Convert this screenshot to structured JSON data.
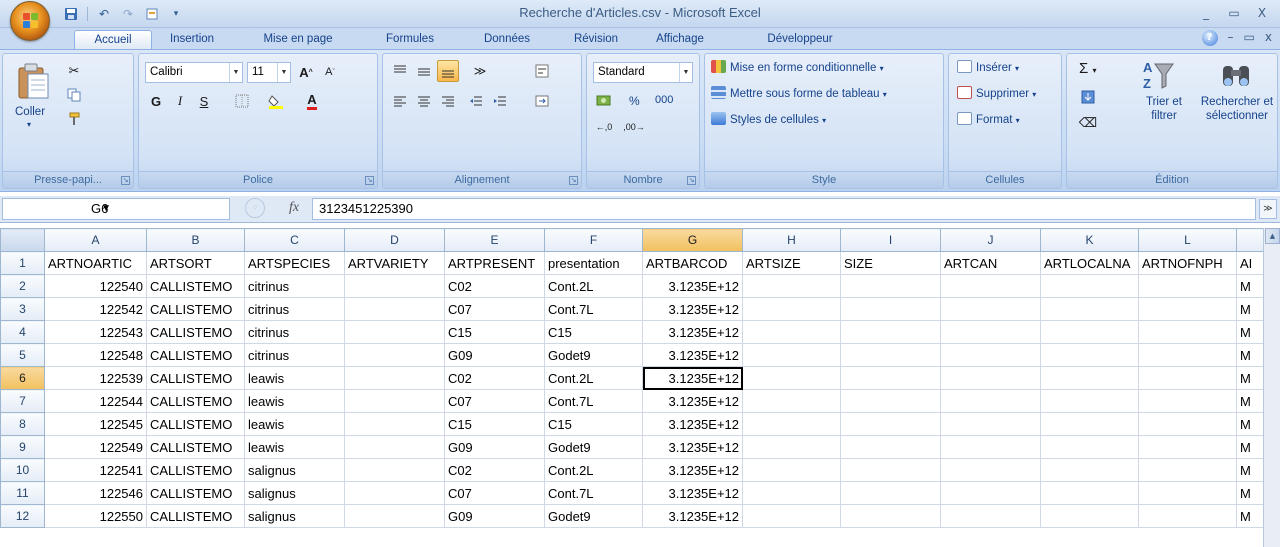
{
  "window": {
    "title": "Recherche d'Articles.csv - Microsoft Excel",
    "controls": [
      "_",
      "▭",
      "X"
    ]
  },
  "tabs": [
    {
      "label": "Accueil",
      "active": true
    },
    {
      "label": "Insertion"
    },
    {
      "label": "Mise en page"
    },
    {
      "label": "Formules"
    },
    {
      "label": "Données"
    },
    {
      "label": "Révision"
    },
    {
      "label": "Affichage"
    },
    {
      "label": "Développeur"
    }
  ],
  "ribbon": {
    "clipboard": {
      "paste_label": "Coller",
      "group_label": "Presse-papi..."
    },
    "font": {
      "name": "Calibri",
      "size": "11",
      "bold": "G",
      "italic": "I",
      "underline": "S",
      "group_label": "Police"
    },
    "alignment": {
      "group_label": "Alignement"
    },
    "number": {
      "format": "Standard",
      "percent": "%",
      "thousands": "000",
      "group_label": "Nombre"
    },
    "style": {
      "conditional": "Mise en forme conditionnelle",
      "table": "Mettre sous forme de tableau",
      "cell_styles": "Styles de cellules",
      "group_label": "Style"
    },
    "cells": {
      "insert": "Insérer",
      "delete": "Supprimer",
      "format": "Format",
      "group_label": "Cellules"
    },
    "editing": {
      "sum": "Σ",
      "sort_line1": "Trier et",
      "sort_line2": "filtrer",
      "find_line1": "Rechercher et",
      "find_line2": "sélectionner",
      "group_label": "Édition"
    }
  },
  "formula_bar": {
    "name_box": "G6",
    "fx": "fx",
    "value": "3123451225390"
  },
  "sheet": {
    "columns": [
      "A",
      "B",
      "C",
      "D",
      "E",
      "F",
      "G",
      "H",
      "I",
      "J",
      "K",
      "L"
    ],
    "selected_column": "G",
    "selected_row": "6",
    "rows": [
      {
        "n": "1",
        "cells": [
          "ARTNOARTIC",
          "ARTSORT",
          "ARTSPECIES",
          "ARTVARIETY",
          "ARTPRESENT",
          "presentation",
          "ARTBARCOD",
          "ARTSIZE",
          "SIZE",
          "ARTCAN",
          "ARTLOCALNA",
          "ARTNOFNPH",
          "AI"
        ]
      },
      {
        "n": "2",
        "cells": [
          "122540",
          "CALLISTEMO",
          "citrinus",
          "",
          "C02",
          "Cont.2L",
          "3.1235E+12",
          "",
          "",
          "",
          "",
          "",
          "M"
        ]
      },
      {
        "n": "3",
        "cells": [
          "122542",
          "CALLISTEMO",
          "citrinus",
          "",
          "C07",
          "Cont.7L",
          "3.1235E+12",
          "",
          "",
          "",
          "",
          "",
          "M"
        ]
      },
      {
        "n": "4",
        "cells": [
          "122543",
          "CALLISTEMO",
          "citrinus",
          "",
          "C15",
          "C15",
          "3.1235E+12",
          "",
          "",
          "",
          "",
          "",
          "M"
        ]
      },
      {
        "n": "5",
        "cells": [
          "122548",
          "CALLISTEMO",
          "citrinus",
          "",
          "G09",
          "Godet9",
          "3.1235E+12",
          "",
          "",
          "",
          "",
          "",
          "M"
        ]
      },
      {
        "n": "6",
        "cells": [
          "122539",
          "CALLISTEMO",
          "leawis",
          "",
          "C02",
          "Cont.2L",
          "3.1235E+12",
          "",
          "",
          "",
          "",
          "",
          "M"
        ]
      },
      {
        "n": "7",
        "cells": [
          "122544",
          "CALLISTEMO",
          "leawis",
          "",
          "C07",
          "Cont.7L",
          "3.1235E+12",
          "",
          "",
          "",
          "",
          "",
          "M"
        ]
      },
      {
        "n": "8",
        "cells": [
          "122545",
          "CALLISTEMO",
          "leawis",
          "",
          "C15",
          "C15",
          "3.1235E+12",
          "",
          "",
          "",
          "",
          "",
          "M"
        ]
      },
      {
        "n": "9",
        "cells": [
          "122549",
          "CALLISTEMO",
          "leawis",
          "",
          "G09",
          "Godet9",
          "3.1235E+12",
          "",
          "",
          "",
          "",
          "",
          "M"
        ]
      },
      {
        "n": "10",
        "cells": [
          "122541",
          "CALLISTEMO",
          "salignus",
          "",
          "C02",
          "Cont.2L",
          "3.1235E+12",
          "",
          "",
          "",
          "",
          "",
          "M"
        ]
      },
      {
        "n": "11",
        "cells": [
          "122546",
          "CALLISTEMO",
          "salignus",
          "",
          "C07",
          "Cont.7L",
          "3.1235E+12",
          "",
          "",
          "",
          "",
          "",
          "M"
        ]
      },
      {
        "n": "12",
        "cells": [
          "122550",
          "CALLISTEMO",
          "salignus",
          "",
          "G09",
          "Godet9",
          "3.1235E+12",
          "",
          "",
          "",
          "",
          "",
          "M"
        ]
      }
    ]
  }
}
